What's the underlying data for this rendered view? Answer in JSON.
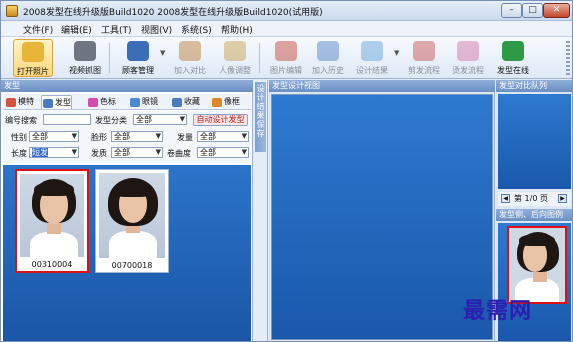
{
  "window": {
    "title": "2008发型在线升级版Build1020 2008发型在线升级版Build1020(试用版)"
  },
  "menu": [
    "文件(F)",
    "编辑(E)",
    "工具(T)",
    "视图(V)",
    "系统(S)",
    "帮助(H)"
  ],
  "toolbar": [
    {
      "label": "打开照片",
      "icon": "open-photo-icon",
      "color": "#e8b43a",
      "state": "active"
    },
    {
      "label": "视频抓图",
      "icon": "camera-icon",
      "color": "#6f7580",
      "state": "normal"
    },
    {
      "label": "顾客管理",
      "icon": "customer-icon",
      "color": "#3a6fb8",
      "state": "normal"
    },
    {
      "label": "加入对比",
      "icon": "add-compare-icon",
      "color": "#b8742a",
      "state": "disabled"
    },
    {
      "label": "人像调整",
      "icon": "portrait-adjust-icon",
      "color": "#c69b3b",
      "state": "disabled"
    },
    {
      "label": "图片编辑",
      "icon": "image-edit-icon",
      "color": "#c23a2e",
      "state": "disabled"
    },
    {
      "label": "加入历史",
      "icon": "add-history-icon",
      "color": "#4a7bc0",
      "state": "disabled"
    },
    {
      "label": "设计结果",
      "icon": "design-result-icon",
      "color": "#5aa0d8",
      "state": "disabled"
    },
    {
      "label": "剪发流程",
      "icon": "scissors-icon",
      "color": "#c4454a",
      "state": "disabled"
    },
    {
      "label": "烫发流程",
      "icon": "perm-icon",
      "color": "#d16aa0",
      "state": "disabled"
    },
    {
      "label": "发型在线",
      "icon": "online-icon",
      "color": "#2e9a46",
      "state": "normal"
    }
  ],
  "left_panel": {
    "title": "发型",
    "tabs": [
      {
        "label": "模特",
        "icon": "model-icon",
        "color": "#d0553a",
        "selected": false
      },
      {
        "label": "发型",
        "icon": "hairstyle-icon",
        "color": "#4a7bc0",
        "selected": true
      },
      {
        "label": "色标",
        "icon": "color-icon",
        "color": "#d44bb0",
        "selected": false
      },
      {
        "label": "眼镜",
        "icon": "glasses-icon",
        "color": "#4a8ad0",
        "selected": false
      },
      {
        "label": "收藏",
        "icon": "favorite-icon",
        "color": "#4a7bc0",
        "selected": false
      },
      {
        "label": "像框",
        "icon": "frame-icon",
        "color": "#e0862a",
        "selected": false
      }
    ],
    "filters": {
      "code_search_label": "编号搜索",
      "category_label": "发型分类",
      "category_value": "全部",
      "auto_design_button": "自动设计发型",
      "row2": [
        {
          "label": "性别",
          "value": "全部"
        },
        {
          "label": "脸形",
          "value": "全部"
        },
        {
          "label": "发量",
          "value": "全部"
        }
      ],
      "row3": [
        {
          "label": "长度",
          "value": "短发"
        },
        {
          "label": "发质",
          "value": "全部"
        },
        {
          "label": "卷曲度",
          "value": "全部"
        }
      ]
    },
    "items": [
      {
        "code": "00310004",
        "selected": true
      },
      {
        "code": "00700018",
        "selected": false
      }
    ]
  },
  "design_strip": {
    "label": "设计结果保存"
  },
  "center_panel": {
    "title": "发型设计视图"
  },
  "right_panel": {
    "title": "发型对比队列",
    "pager": {
      "text": "第 1/0 页"
    },
    "profile_title": "发型侧、后向图例"
  },
  "watermark": "最需网"
}
